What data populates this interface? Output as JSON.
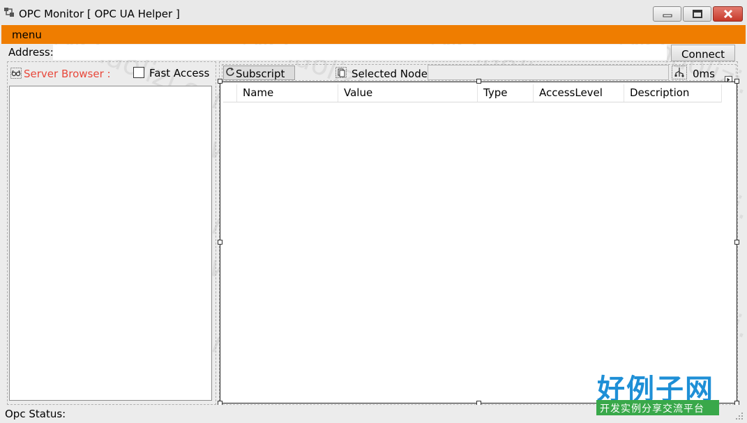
{
  "window": {
    "title": "OPC Monitor [ OPC UA Helper ]"
  },
  "menubar": {
    "items": [
      "menu"
    ],
    "color": "#ef7d00"
  },
  "address": {
    "label": "Address:",
    "value": "",
    "connect_label": "Connect"
  },
  "left_panel": {
    "server_browser_label": "Server Browser :",
    "fast_access_label": "Fast Access",
    "fast_access_checked": false,
    "accent_color": "#e8483b"
  },
  "toolbar": {
    "subscript_label": "Subscript",
    "selected_node_label": "Selected Node",
    "selected_node_value": "",
    "timing_label": "0ms"
  },
  "list": {
    "columns": [
      "Name",
      "Value",
      "Type",
      "AccessLevel",
      "Description"
    ],
    "rows": []
  },
  "status": {
    "label": "Opc Status:"
  },
  "watermark": {
    "text": "www.haolizi.com",
    "logo_title": "好例子网",
    "logo_subtitle": "开发实例分享交流平台"
  },
  "icons": {
    "app": "plug-network-icon",
    "server_browser": "glasses-icon",
    "subscript": "refresh-icon",
    "selected_node": "node-icon",
    "timing": "usb-icon"
  }
}
